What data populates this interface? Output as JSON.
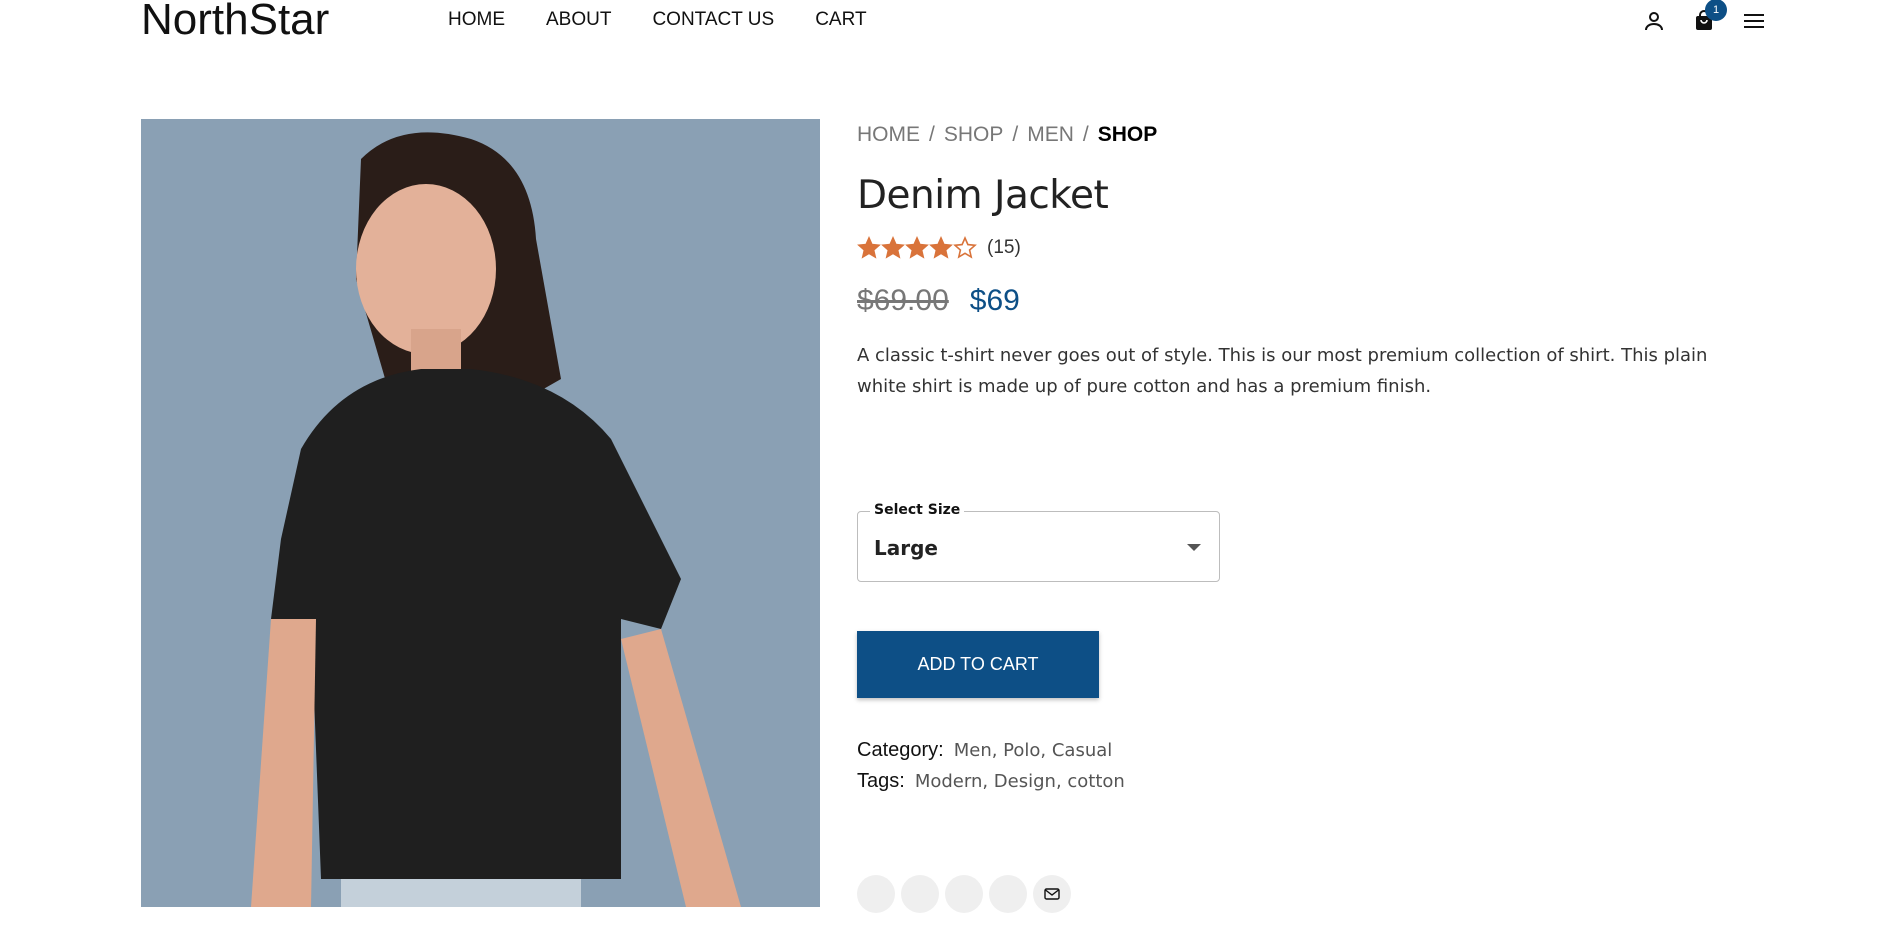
{
  "header": {
    "logo": "NorthStar",
    "nav": [
      "HOME",
      "ABOUT",
      "CONTACT US",
      "CART"
    ],
    "cart_count": "1",
    "icons": [
      "user-icon",
      "shopping-bag-icon",
      "menu-icon"
    ]
  },
  "product": {
    "breadcrumb": [
      "HOME",
      "SHOP",
      "MEN",
      "SHOP"
    ],
    "title": "Denim Jacket",
    "rating_value": 4,
    "rating_max": 5,
    "rating_count": "(15)",
    "old_price": "$69.00",
    "price": "$69",
    "description": "A classic t-shirt never goes out of style. This is our most premium collection of shirt. This plain white shirt is made up of pure cotton and has a premium finish.",
    "size_label": "Select Size",
    "size_value": "Large",
    "add_to_cart": "ADD TO CART",
    "category_label": "Category:",
    "category_value": "Men, Polo, Casual",
    "tags_label": "Tags:",
    "tags_value": "Modern, Design, cotton",
    "share_icons": [
      "share-icon",
      "share-icon",
      "share-icon",
      "share-icon",
      "email-icon"
    ]
  },
  "colors": {
    "accent": "#0d4f86",
    "star": "#d9733a",
    "image_bg": "#8aa0b4"
  }
}
